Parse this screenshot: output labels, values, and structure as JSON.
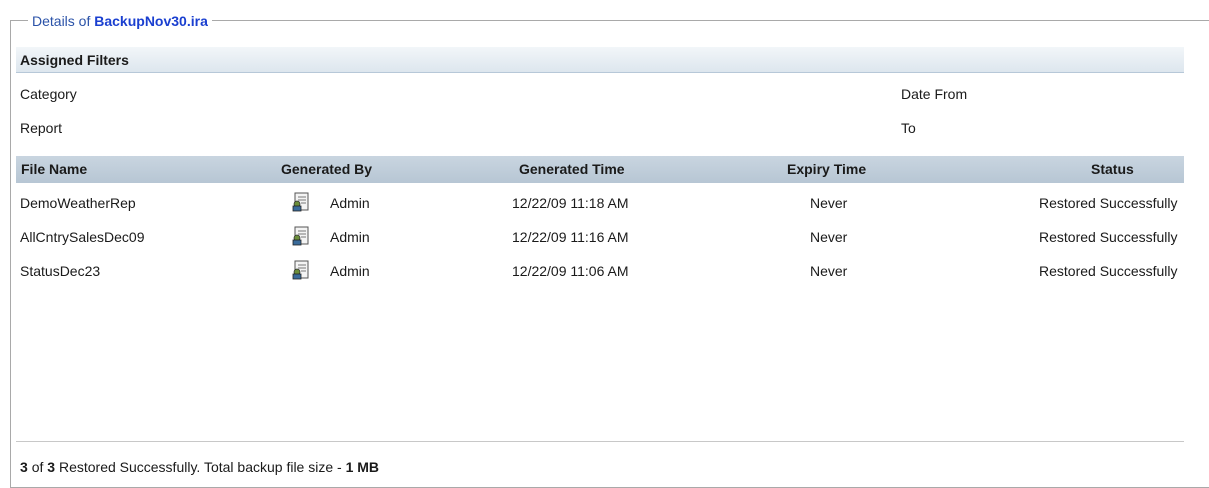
{
  "legend": {
    "prefix": "Details of",
    "file": "BackupNov30.ira"
  },
  "filters": {
    "header": "Assigned Filters",
    "category_label": "Category",
    "report_label": "Report",
    "date_from_label": "Date From",
    "to_label": "To"
  },
  "table": {
    "columns": [
      "File Name",
      "Generated By",
      "Generated Time",
      "Expiry Time",
      "Status"
    ],
    "rows": [
      {
        "file_name": "DemoWeatherRep",
        "generated_by": "Admin",
        "generated_time": "12/22/09 11:18 AM",
        "expiry_time": "Never",
        "status": "Restored Successfully"
      },
      {
        "file_name": "AllCntrySalesDec09",
        "generated_by": "Admin",
        "generated_time": "12/22/09 11:16 AM",
        "expiry_time": "Never",
        "status": "Restored Successfully"
      },
      {
        "file_name": "StatusDec23",
        "generated_by": "Admin",
        "generated_time": "12/22/09 11:06 AM",
        "expiry_time": "Never",
        "status": "Restored Successfully"
      }
    ]
  },
  "summary": {
    "restored_count": "3",
    "of_text": "of",
    "total_count": "3",
    "restored_text": "Restored Successfully. Total backup file size -",
    "size": "1 MB"
  },
  "colors": {
    "legend_text": "#2a52a8",
    "header_bg": "#b7c6d4",
    "section_bg": "#dde6ee"
  },
  "icons": {
    "generated_by": "report-user-icon"
  }
}
